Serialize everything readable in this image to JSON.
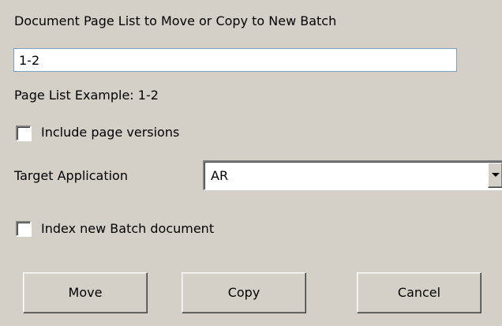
{
  "dialog": {
    "page_list_label": "Document Page List to Move or Copy to New Batch",
    "page_list_value": "1-2",
    "example_label": "Page List Example: 1-2",
    "include_versions": {
      "label": "Include page versions",
      "checked": false
    },
    "target_application": {
      "label": "Target Application",
      "selected": "AR"
    },
    "index_new_batch": {
      "label": "Index new Batch document",
      "checked": false
    },
    "buttons": {
      "move": "Move",
      "copy": "Copy",
      "cancel": "Cancel"
    }
  }
}
